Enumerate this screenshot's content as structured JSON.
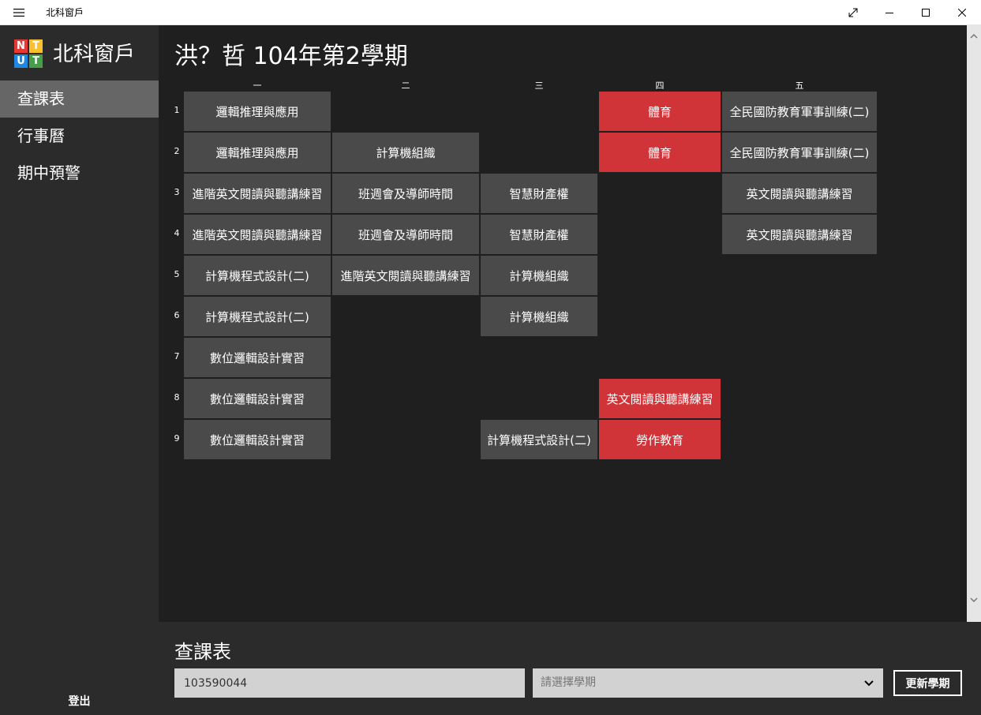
{
  "window": {
    "title": "北科窗戶",
    "controls": [
      "fullscreen-icon",
      "minimize-icon",
      "maximize-icon",
      "close-icon"
    ]
  },
  "sidebar": {
    "logo_letters": [
      "N",
      "T",
      "U",
      "T"
    ],
    "logo_colors": [
      "#e53935",
      "#fbc02d",
      "#1e88e5",
      "#43a047"
    ],
    "brand": "北科窗戶",
    "items": [
      {
        "label": "查課表",
        "selected": true
      },
      {
        "label": "行事曆",
        "selected": false
      },
      {
        "label": "期中預警",
        "selected": false
      }
    ],
    "logout_label": "登出"
  },
  "main": {
    "title": "洪？哲 104年第2學期",
    "days": [
      "一",
      "二",
      "三",
      "四",
      "五"
    ],
    "periods": [
      "1",
      "2",
      "3",
      "4",
      "5",
      "6",
      "7",
      "8",
      "9"
    ],
    "cells": [
      {
        "day": 0,
        "period": 0,
        "name": "邏輯推理與應用",
        "highlight": false
      },
      {
        "day": 0,
        "period": 1,
        "name": "邏輯推理與應用",
        "highlight": false
      },
      {
        "day": 0,
        "period": 2,
        "name": "進階英文閱讀與聽講練習",
        "highlight": false
      },
      {
        "day": 0,
        "period": 3,
        "name": "進階英文閱讀與聽講練習",
        "highlight": false
      },
      {
        "day": 0,
        "period": 4,
        "name": "計算機程式設計(二)",
        "highlight": false
      },
      {
        "day": 0,
        "period": 5,
        "name": "計算機程式設計(二)",
        "highlight": false
      },
      {
        "day": 0,
        "period": 6,
        "name": "數位邏輯設計實習",
        "highlight": false
      },
      {
        "day": 0,
        "period": 7,
        "name": "數位邏輯設計實習",
        "highlight": false
      },
      {
        "day": 0,
        "period": 8,
        "name": "數位邏輯設計實習",
        "highlight": false
      },
      {
        "day": 1,
        "period": 1,
        "name": "計算機組織",
        "highlight": false
      },
      {
        "day": 1,
        "period": 2,
        "name": "班週會及導師時間",
        "highlight": false
      },
      {
        "day": 1,
        "period": 3,
        "name": "班週會及導師時間",
        "highlight": false
      },
      {
        "day": 1,
        "period": 4,
        "name": "進階英文閱讀與聽講練習",
        "highlight": false
      },
      {
        "day": 2,
        "period": 2,
        "name": "智慧財產權",
        "highlight": false
      },
      {
        "day": 2,
        "period": 3,
        "name": "智慧財產權",
        "highlight": false
      },
      {
        "day": 2,
        "period": 4,
        "name": "計算機組織",
        "highlight": false
      },
      {
        "day": 2,
        "period": 5,
        "name": "計算機組織",
        "highlight": false
      },
      {
        "day": 2,
        "period": 8,
        "name": "計算機程式設計(二)",
        "highlight": false
      },
      {
        "day": 3,
        "period": 0,
        "name": "體育",
        "highlight": true
      },
      {
        "day": 3,
        "period": 1,
        "name": "體育",
        "highlight": true
      },
      {
        "day": 3,
        "period": 7,
        "name": "英文閱讀與聽講練習",
        "highlight": true
      },
      {
        "day": 3,
        "period": 8,
        "name": "勞作教育",
        "highlight": true
      },
      {
        "day": 4,
        "period": 0,
        "name": "全民國防教育軍事訓練(二)",
        "highlight": false
      },
      {
        "day": 4,
        "period": 1,
        "name": "全民國防教育軍事訓練(二)",
        "highlight": false
      },
      {
        "day": 4,
        "period": 2,
        "name": "英文閱讀與聽講練習",
        "highlight": false
      },
      {
        "day": 4,
        "period": 3,
        "name": "英文閱讀與聽講練習",
        "highlight": false
      }
    ]
  },
  "bottom": {
    "title": "查課表",
    "student_id": "103590044",
    "semester_placeholder": "請選擇學期",
    "update_label": "更新學期"
  },
  "colors": {
    "background": "#1f1f1f",
    "sidebar": "#2b2b2b",
    "cell": "#4a4a4a",
    "highlight": "#d13438",
    "nav_selected": "#666666"
  }
}
